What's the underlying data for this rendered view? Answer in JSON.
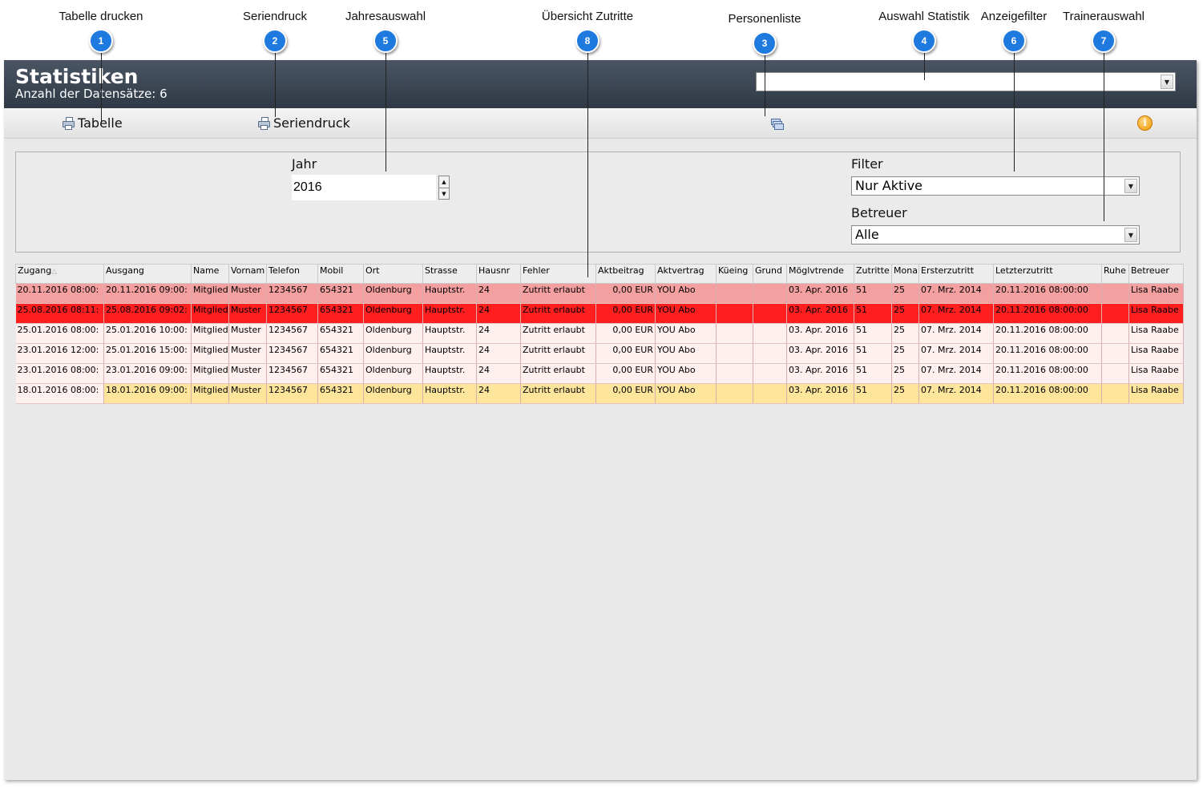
{
  "annotations": [
    {
      "label": "Tabelle drucken",
      "badge": "1"
    },
    {
      "label": "Seriendruck",
      "badge": "2"
    },
    {
      "label": "Jahresauswahl",
      "badge": "5"
    },
    {
      "label": "Übersicht Zutritte",
      "badge": "8"
    },
    {
      "label": "Personenliste",
      "badge": "3"
    },
    {
      "label": "Auswahl Statistik",
      "badge": "4"
    },
    {
      "label": "Anzeigefilter",
      "badge": "6"
    },
    {
      "label": "Trainerauswahl",
      "badge": "7"
    }
  ],
  "header": {
    "title": "Statistiken",
    "count": "Anzahl der Datensätze: 6",
    "statistic_select_value": ""
  },
  "toolbar": {
    "table_label": "Tabelle",
    "mail_merge_label": "Seriendruck",
    "person_list_icon": "person-list-icon",
    "info_icon": "info-icon"
  },
  "filters": {
    "year_label": "Jahr",
    "year_value": "2016",
    "filter_label": "Filter",
    "filter_value": "Nur Aktive",
    "trainer_label": "Betreuer",
    "trainer_value": "Alle"
  },
  "table": {
    "columns": [
      "Zugang",
      "Ausgang",
      "Name",
      "Vornam",
      "Telefon",
      "Mobil",
      "Ort",
      "Strasse",
      "Hausnr",
      "Fehler",
      "Aktbeitrag",
      "Aktvertrag",
      "Küeing",
      "Grund",
      "Möglvtrende",
      "Zutritte",
      "Mona",
      "Ersterzutritt",
      "Letzterzutritt",
      "Ruhe",
      "Betreuer"
    ],
    "sort_indicator": "△",
    "rows": [
      [
        "20.11.2016 08:00:",
        "20.11.2016 09:00:",
        "Mitglied",
        "Muster",
        "1234567",
        "654321",
        "Oldenburg",
        "Hauptstr.",
        "24",
        "Zutritt erlaubt",
        "0,00 EUR",
        "YOU Abo",
        "",
        "",
        "03. Apr. 2016",
        "51",
        "25",
        "07. Mrz. 2014",
        "20.11.2016 08:00:00",
        "",
        "Lisa Raabe"
      ],
      [
        "25.08.2016 08:11:",
        "25.08.2016 09:02:",
        "Mitglied",
        "Muster",
        "1234567",
        "654321",
        "Oldenburg",
        "Hauptstr.",
        "24",
        "Zutritt erlaubt",
        "0,00 EUR",
        "YOU Abo",
        "",
        "",
        "03. Apr. 2016",
        "51",
        "25",
        "07. Mrz. 2014",
        "20.11.2016 08:00:00",
        "",
        "Lisa Raabe"
      ],
      [
        "25.01.2016 08:00:",
        "25.01.2016 10:00:",
        "Mitglied",
        "Muster",
        "1234567",
        "654321",
        "Oldenburg",
        "Hauptstr.",
        "24",
        "Zutritt erlaubt",
        "0,00 EUR",
        "YOU Abo",
        "",
        "",
        "03. Apr. 2016",
        "51",
        "25",
        "07. Mrz. 2014",
        "20.11.2016 08:00:00",
        "",
        "Lisa Raabe"
      ],
      [
        "23.01.2016 12:00:",
        "25.01.2016 15:00:",
        "Mitglied",
        "Muster",
        "1234567",
        "654321",
        "Oldenburg",
        "Hauptstr.",
        "24",
        "Zutritt erlaubt",
        "0,00 EUR",
        "YOU Abo",
        "",
        "",
        "03. Apr. 2016",
        "51",
        "25",
        "07. Mrz. 2014",
        "20.11.2016 08:00:00",
        "",
        "Lisa Raabe"
      ],
      [
        "23.01.2016 08:00:",
        "23.01.2016 09:00:",
        "Mitglied",
        "Muster",
        "1234567",
        "654321",
        "Oldenburg",
        "Hauptstr.",
        "24",
        "Zutritt erlaubt",
        "0,00 EUR",
        "YOU Abo",
        "",
        "",
        "03. Apr. 2016",
        "51",
        "25",
        "07. Mrz. 2014",
        "20.11.2016 08:00:00",
        "",
        "Lisa Raabe"
      ],
      [
        "18.01.2016 08:00:",
        "18.01.2016 09:00:",
        "Mitglied",
        "Muster",
        "1234567",
        "654321",
        "Oldenburg",
        "Hauptstr.",
        "24",
        "Zutritt erlaubt",
        "0,00 EUR",
        "YOU Abo",
        "",
        "",
        "03. Apr. 2016",
        "51",
        "25",
        "07. Mrz. 2014",
        "20.11.2016 08:00:00",
        "",
        "Lisa Raabe"
      ]
    ],
    "row_colors": [
      "#f5a0a0",
      "#ff1f1f",
      "#fff0f0",
      "#fff0f0",
      "#fff0f0",
      "#fde59c"
    ]
  }
}
